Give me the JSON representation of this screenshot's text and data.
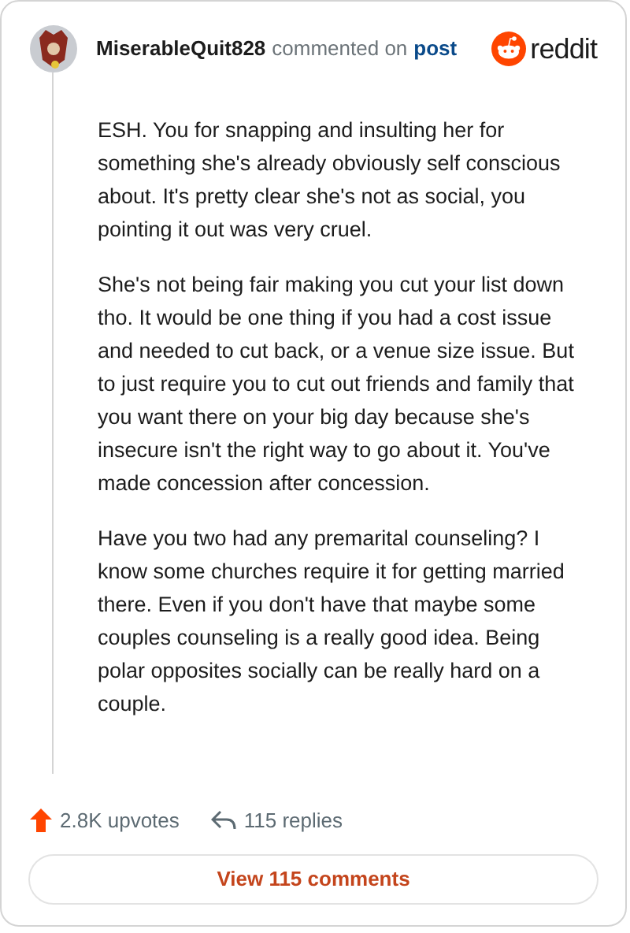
{
  "header": {
    "username": "MiserableQuit828",
    "action": "commented on",
    "link": "post",
    "logo_text": "reddit"
  },
  "comment": {
    "paragraphs": [
      "ESH. You for snapping and insulting her for something she's already obviously self conscious about. It's pretty clear she's not as social, you pointing it out was very cruel.",
      "She's not being fair making you cut your list down tho. It would be one thing if you had a cost issue and needed to cut back, or a venue size issue. But to just require you to cut out friends and family that you want there on your big day because she's insecure isn't the right way to go about it. You've made concession after concession.",
      "Have you two had any premarital counseling? I know some churches require it for getting married there. Even if you don't have that maybe some couples counseling is a really good idea. Being polar opposites socially can be really hard on a couple."
    ]
  },
  "footer": {
    "upvotes": "2.8K upvotes",
    "replies": "115 replies",
    "button": "View 115 comments"
  }
}
